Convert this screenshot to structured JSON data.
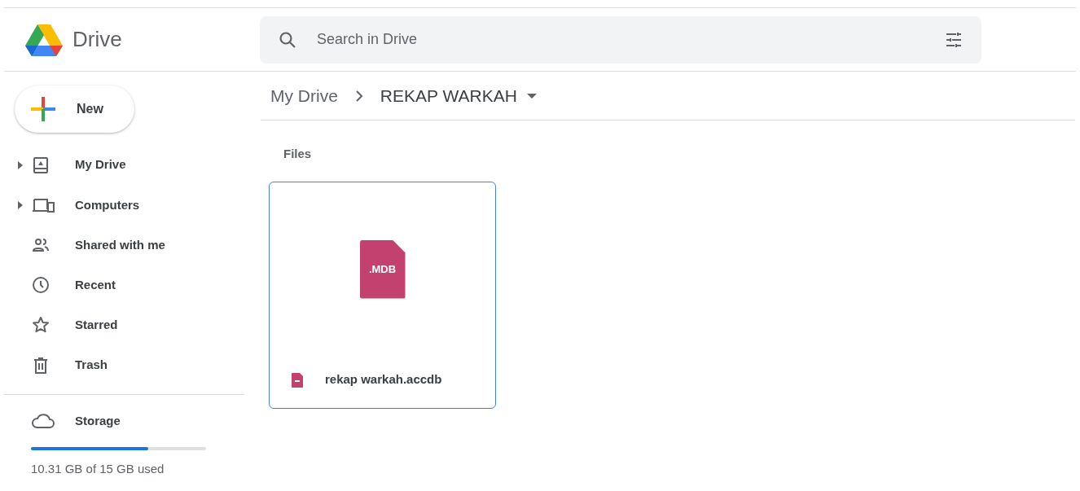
{
  "app": {
    "name": "Drive"
  },
  "search": {
    "placeholder": "Search in Drive"
  },
  "new_button": {
    "label": "New"
  },
  "nav": [
    {
      "label": "My Drive",
      "expandable": true
    },
    {
      "label": "Computers",
      "expandable": true
    },
    {
      "label": "Shared with me",
      "expandable": false
    },
    {
      "label": "Recent",
      "expandable": false
    },
    {
      "label": "Starred",
      "expandable": false
    },
    {
      "label": "Trash",
      "expandable": false
    }
  ],
  "storage": {
    "label": "Storage",
    "level": 0.67,
    "usage": "10.31 GB of 15 GB used"
  },
  "breadcrumb": [
    {
      "label": "My Drive"
    },
    {
      "label": "REKAP WARKAH"
    }
  ],
  "section": "Files",
  "files": [
    {
      "thumbnail_label": ".MDB",
      "name": "rekap warkah.accdb",
      "selected": true
    }
  ]
}
